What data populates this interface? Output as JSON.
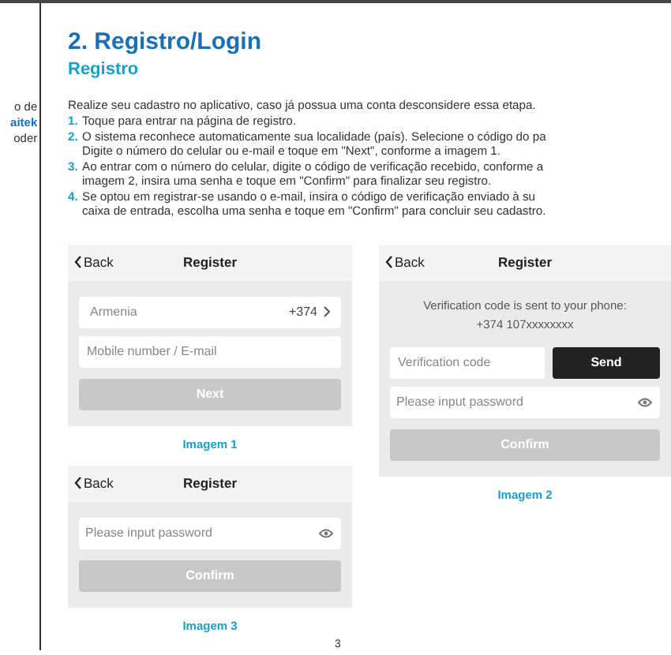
{
  "left_column": {
    "lines": [
      "o de",
      "aitek",
      "oder"
    ]
  },
  "heading": "2. Registro/Login",
  "subheading": "Registro",
  "intro": "Realize seu cadastro no aplicativo, caso já possua uma conta desconsidere essa etapa.",
  "steps": [
    {
      "number": "1.",
      "lines": [
        "Toque para entrar na página de registro."
      ]
    },
    {
      "number": "2.",
      "lines": [
        "O sistema reconhece automaticamente sua localidade (país). Selecione o código do pa",
        "Digite o número do celular ou e-mail e toque em \"Next\", conforme a imagem 1."
      ]
    },
    {
      "number": "3.",
      "lines": [
        "Ao entrar com o número do celular, digite o código de verificação recebido, conforme a",
        "imagem 2, insira uma senha e toque em \"Confirm\" para finalizar seu registro."
      ]
    },
    {
      "number": "4.",
      "lines": [
        "Se optou em registrar-se usando o e-mail, insira o código de verificação enviado à su",
        "caixa de entrada, escolha uma senha e toque em \"Confirm\" para concluir seu cadastro."
      ]
    }
  ],
  "screens": [
    {
      "back": "Back",
      "title": "Register",
      "caption": "Imagem 1",
      "items": [
        {
          "kind": "country",
          "label": "Armenia",
          "code": "+374"
        },
        {
          "kind": "field",
          "placeholder": "Mobile number / E-mail"
        },
        {
          "kind": "button",
          "label": "Next"
        }
      ]
    },
    {
      "back": "Back",
      "title": "Register",
      "caption": "Imagem 3",
      "items": [
        {
          "kind": "password",
          "placeholder": "Please input password"
        },
        {
          "kind": "button",
          "label": "Confirm"
        }
      ]
    },
    {
      "back": "Back",
      "title": "Register",
      "caption": "Imagem 2",
      "items": [
        {
          "kind": "note",
          "lines": [
            "Verification code is sent to your phone:",
            "+374 107xxxxxxxx"
          ]
        },
        {
          "kind": "code",
          "placeholder": "Verification code",
          "button": "Send"
        },
        {
          "kind": "password",
          "placeholder": "Please input password"
        },
        {
          "kind": "button",
          "label": "Confirm"
        }
      ]
    }
  ],
  "page_number": "3"
}
